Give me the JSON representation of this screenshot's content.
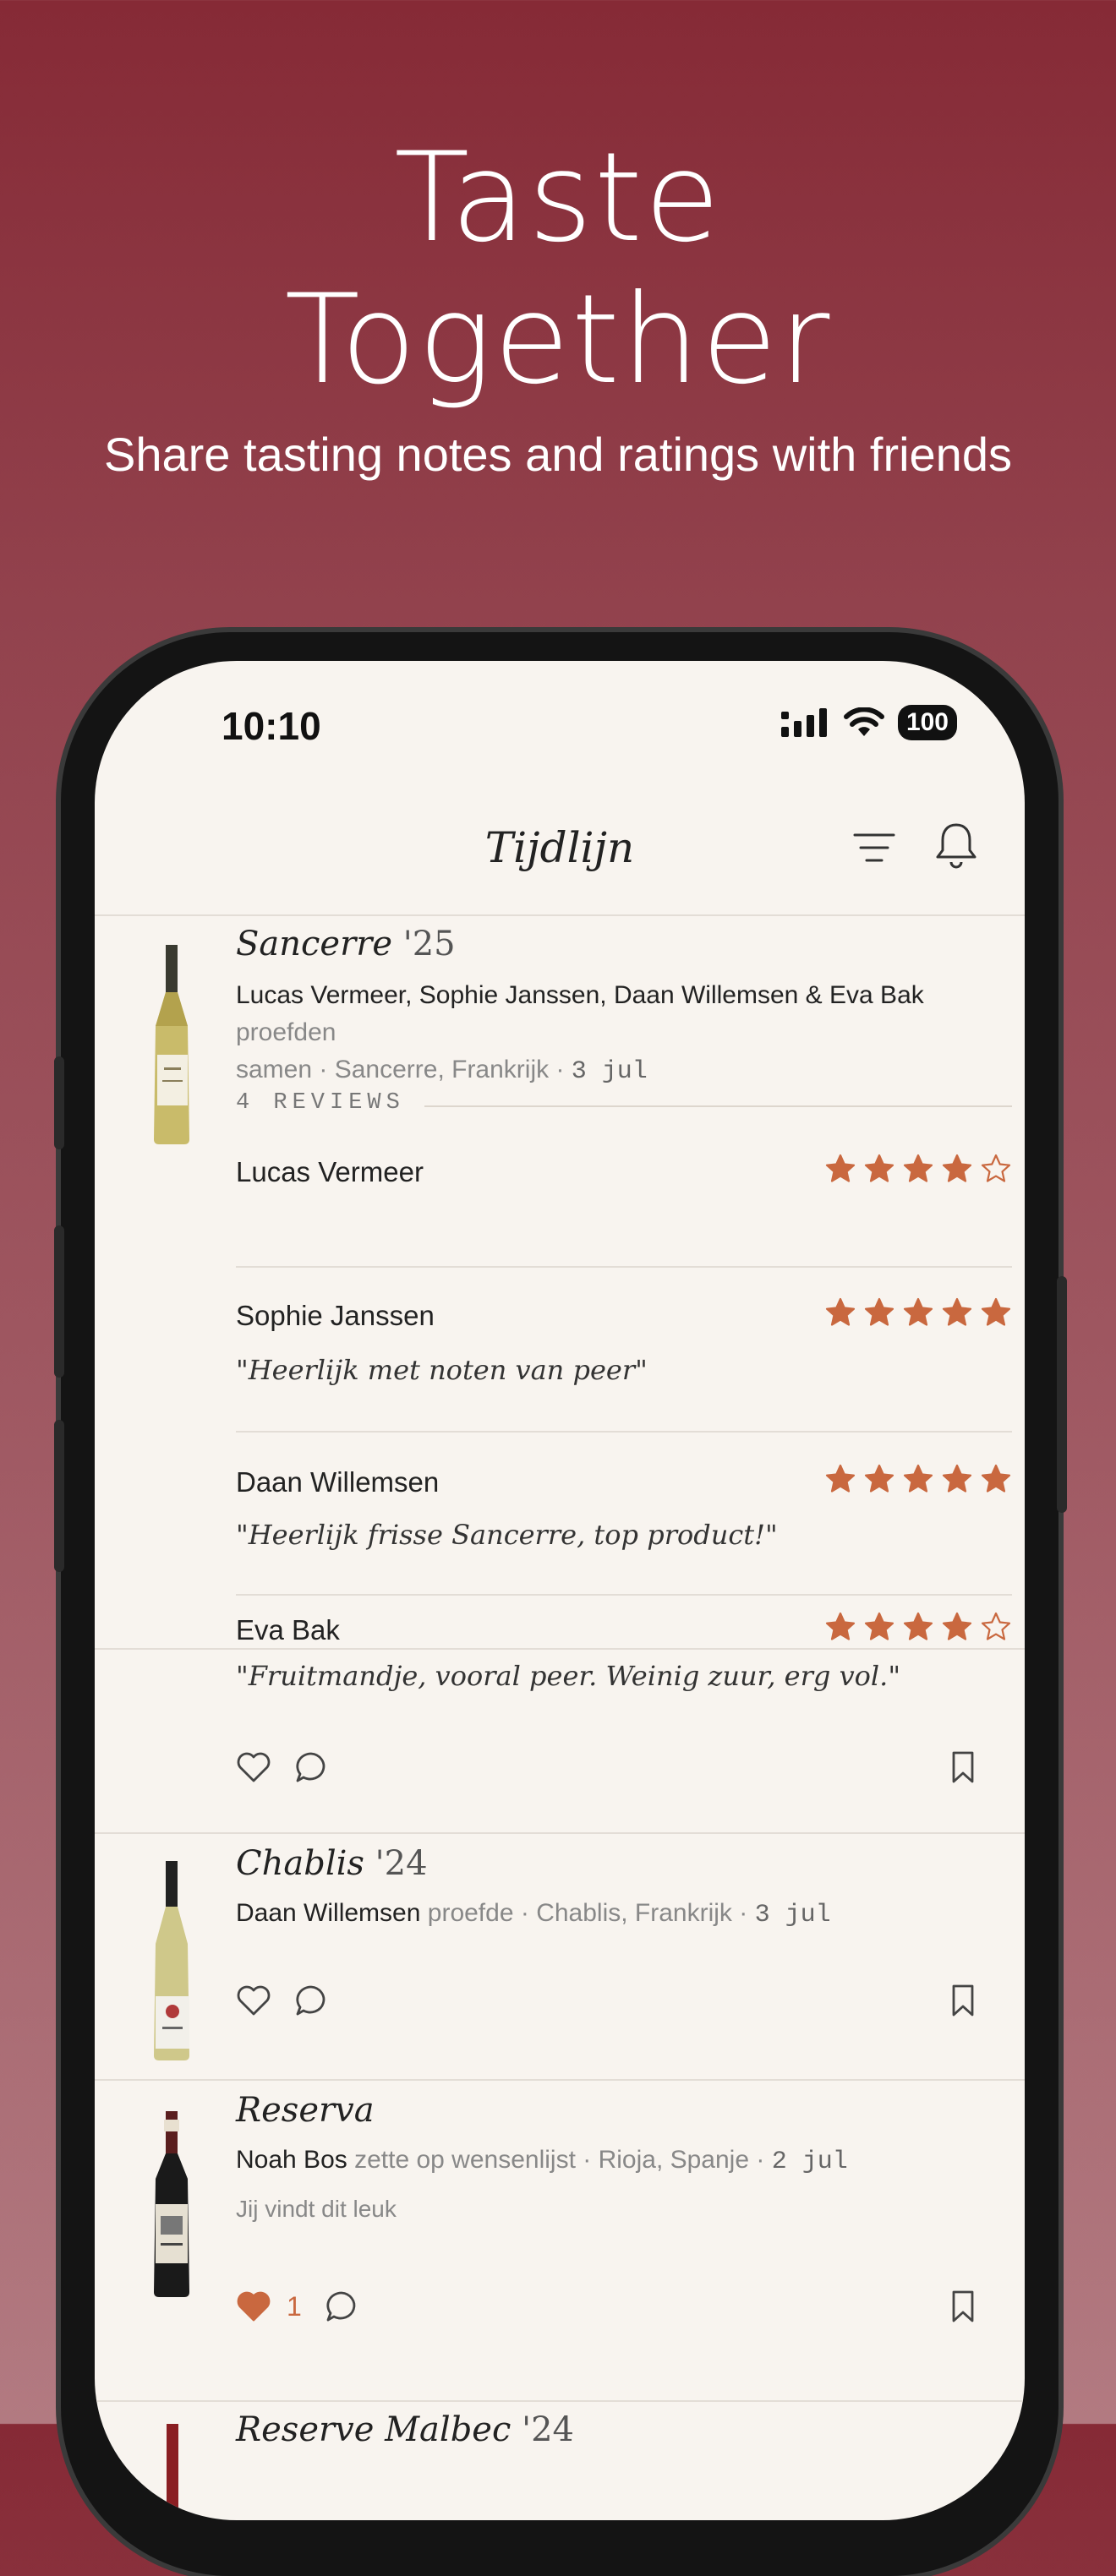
{
  "promo": {
    "headline_line1": "Taste",
    "headline_line2": "Together",
    "subheadline": "Share tasting notes and ratings with friends"
  },
  "status_bar": {
    "time": "10:10",
    "battery": "100"
  },
  "nav": {
    "title": "Tijdlijn"
  },
  "colors": {
    "accent": "#c9683f",
    "brand_bg": "#862a36",
    "screen_bg": "#f8f4ef"
  },
  "posts": [
    {
      "wine": "Sancerre",
      "vintage": "'25",
      "people": "Lucas Vermeer, Sophie Janssen, Daan Willemsen & Eva Bak",
      "action_line1": "proefden",
      "action_line2": "samen",
      "location": "Sancerre, Frankrijk",
      "date": "3 jul",
      "reviews_label": "4 REVIEWS",
      "reviews": [
        {
          "name": "Lucas Vermeer",
          "rating": 4,
          "quote": ""
        },
        {
          "name": "Sophie Janssen",
          "rating": 5,
          "quote": "\"Heerlijk met noten van peer\""
        },
        {
          "name": "Daan Willemsen",
          "rating": 5,
          "quote": "\"Heerlijk frisse Sancerre, top product!\""
        },
        {
          "name": "Eva Bak",
          "rating": 4,
          "quote": "\"Fruitmandje, vooral peer. Weinig zuur, erg vol.\""
        }
      ]
    },
    {
      "wine": "Chablis",
      "vintage": "'24",
      "person": "Daan Willemsen",
      "action": "proefde",
      "location": "Chablis, Frankrijk",
      "date": "3 jul"
    },
    {
      "wine": "Reserva",
      "person": "Noah Bos",
      "action": "zette op wensenlijst",
      "location": "Rioja, Spanje",
      "date": "2 jul",
      "liked_note": "Jij vindt dit leuk",
      "like_count": "1"
    },
    {
      "wine": "Reserve Malbec",
      "vintage": "'24"
    }
  ]
}
